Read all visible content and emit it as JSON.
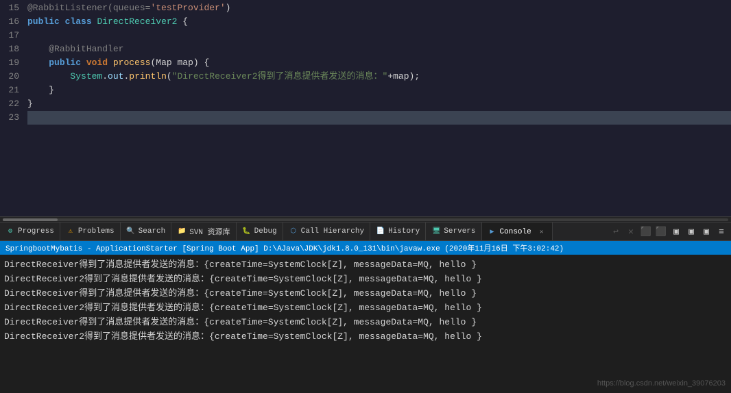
{
  "editor": {
    "lines": [
      {
        "num": "15",
        "content": "@RabbitListener(queues= 'testProvider')",
        "type": "annotation-line",
        "highlight": false
      },
      {
        "num": "16",
        "content": "public class DirectReceiver2 {",
        "type": "class-decl",
        "highlight": false
      },
      {
        "num": "17",
        "content": "",
        "type": "empty",
        "highlight": false
      },
      {
        "num": "18",
        "content": "    @RabbitHandler",
        "type": "annotation-line",
        "highlight": false
      },
      {
        "num": "19",
        "content": "    public void process(Map map) {",
        "type": "method-decl",
        "highlight": false
      },
      {
        "num": "20",
        "content": "        System.out.println(\"DirectReceiver2得到了消息提供者发送的消息：\"+map);",
        "type": "code",
        "highlight": false
      },
      {
        "num": "21",
        "content": "    }",
        "type": "brace",
        "highlight": false
      },
      {
        "num": "22",
        "content": "}",
        "type": "brace",
        "highlight": false
      },
      {
        "num": "23",
        "content": "",
        "type": "empty",
        "highlight": true
      }
    ]
  },
  "tabs": {
    "items": [
      {
        "id": "progress",
        "icon": "⚙",
        "label": "Progress",
        "active": false,
        "closable": false
      },
      {
        "id": "problems",
        "icon": "⚠",
        "label": "Problems",
        "active": false,
        "closable": false
      },
      {
        "id": "search",
        "icon": "🔍",
        "label": "Search",
        "active": false,
        "closable": false
      },
      {
        "id": "svn",
        "icon": "📁",
        "label": "SVN 资源库",
        "active": false,
        "closable": false
      },
      {
        "id": "debug",
        "icon": "🐛",
        "label": "Debug",
        "active": false,
        "closable": false
      },
      {
        "id": "callhierarchy",
        "icon": "⬡",
        "label": "Call Hierarchy",
        "active": false,
        "closable": false
      },
      {
        "id": "history",
        "icon": "📄",
        "label": "History",
        "active": false,
        "closable": false
      },
      {
        "id": "servers",
        "icon": "🖥",
        "label": "Servers",
        "active": false,
        "closable": false
      },
      {
        "id": "console",
        "icon": "▶",
        "label": "Console",
        "active": true,
        "closable": true
      }
    ]
  },
  "path_bar": {
    "text": "SpringbootMybatis - ApplicationStarter [Spring Boot App] D:\\AJava\\JDK\\jdk1.8.0_131\\bin\\javaw.exe (2020年11月16日 下午3:02:42)"
  },
  "console": {
    "lines": [
      "DirectReceiver得到了消息提供者发送的消息：{createTime=SystemClock[Z], messageData=MQ, hello }",
      "DirectReceiver2得到了消息提供者发送的消息：{createTime=SystemClock[Z], messageData=MQ, hello }",
      "DirectReceiver得到了消息提供者发送的消息：{createTime=SystemClock[Z], messageData=MQ, hello }",
      "DirectReceiver2得到了消息提供者发送的消息：{createTime=SystemClock[Z], messageData=MQ, hello }",
      "DirectReceiver得到了消息提供者发送的消息：{createTime=SystemClock[Z], messageData=MQ, hello }",
      "DirectReceiver2得到了消息提供者发送的消息：{createTime=SystemClock[Z], messageData=MQ, hello }"
    ]
  },
  "watermark": "https://blog.csdn.net/weixin_39076203",
  "toolbar_icons": [
    "↩",
    "✕",
    "⬛",
    "⬛",
    "▣",
    "▣",
    "▣",
    "≡"
  ]
}
